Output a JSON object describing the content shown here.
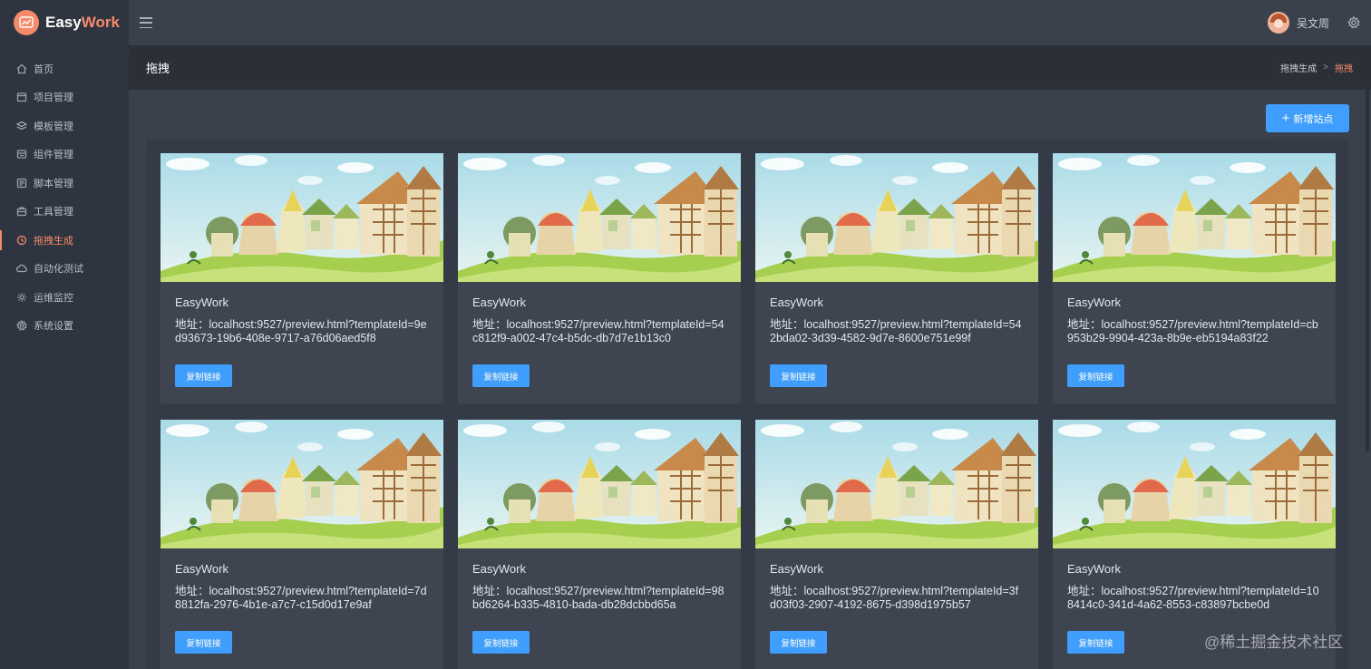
{
  "brand": {
    "name_part1": "Easy",
    "name_part2": "Work"
  },
  "sidebar": {
    "items": [
      {
        "label": "首页",
        "icon": "home-icon",
        "active": false
      },
      {
        "label": "项目管理",
        "icon": "folder-icon",
        "active": false
      },
      {
        "label": "模板管理",
        "icon": "layers-icon",
        "active": false
      },
      {
        "label": "组件管理",
        "icon": "component-icon",
        "active": false
      },
      {
        "label": "脚本管理",
        "icon": "script-icon",
        "active": false
      },
      {
        "label": "工具管理",
        "icon": "toolbox-icon",
        "active": false
      },
      {
        "label": "拖拽生成",
        "icon": "drag-icon",
        "active": true
      },
      {
        "label": "自动化测试",
        "icon": "cloud-icon",
        "active": false
      },
      {
        "label": "运维监控",
        "icon": "monitor-icon",
        "active": false
      },
      {
        "label": "系统设置",
        "icon": "gear-icon",
        "active": false
      }
    ]
  },
  "header": {
    "username": "吴文周"
  },
  "titlebar": {
    "title": "拖拽",
    "breadcrumb": {
      "parent": "拖拽生成",
      "separator": ">",
      "current": "拖拽"
    }
  },
  "toolbar": {
    "add_label": "新增站点"
  },
  "cards": [
    {
      "title": "EasyWork",
      "address": "地址：localhost:9527/preview.html?templateId=9ed93673-19b6-408e-9717-a76d06aed5f8",
      "button": "复制链接"
    },
    {
      "title": "EasyWork",
      "address": "地址：localhost:9527/preview.html?templateId=54c812f9-a002-47c4-b5dc-db7d7e1b13c0",
      "button": "复制链接"
    },
    {
      "title": "EasyWork",
      "address": "地址：localhost:9527/preview.html?templateId=542bda02-3d39-4582-9d7e-8600e751e99f",
      "button": "复制链接"
    },
    {
      "title": "EasyWork",
      "address": "地址：localhost:9527/preview.html?templateId=cb953b29-9904-423a-8b9e-eb5194a83f22",
      "button": "复制链接"
    },
    {
      "title": "EasyWork",
      "address": "地址：localhost:9527/preview.html?templateId=7d8812fa-2976-4b1e-a7c7-c15d0d17e9af",
      "button": "复制链接"
    },
    {
      "title": "EasyWork",
      "address": "地址：localhost:9527/preview.html?templateId=98bd6264-b335-4810-bada-db28dcbbd65a",
      "button": "复制链接"
    },
    {
      "title": "EasyWork",
      "address": "地址：localhost:9527/preview.html?templateId=3fd03f03-2907-4192-8675-d398d1975b57",
      "button": "复制链接"
    },
    {
      "title": "EasyWork",
      "address": "地址：localhost:9527/preview.html?templateId=108414c0-341d-4a62-8553-c83897bcbe0d",
      "button": "复制链接"
    }
  ],
  "watermark": "@稀土掘金技术社区",
  "colors": {
    "accent": "#f58a6a",
    "primary": "#409eff",
    "sidebar_bg": "#2f3540",
    "content_bg": "#3a404c"
  }
}
